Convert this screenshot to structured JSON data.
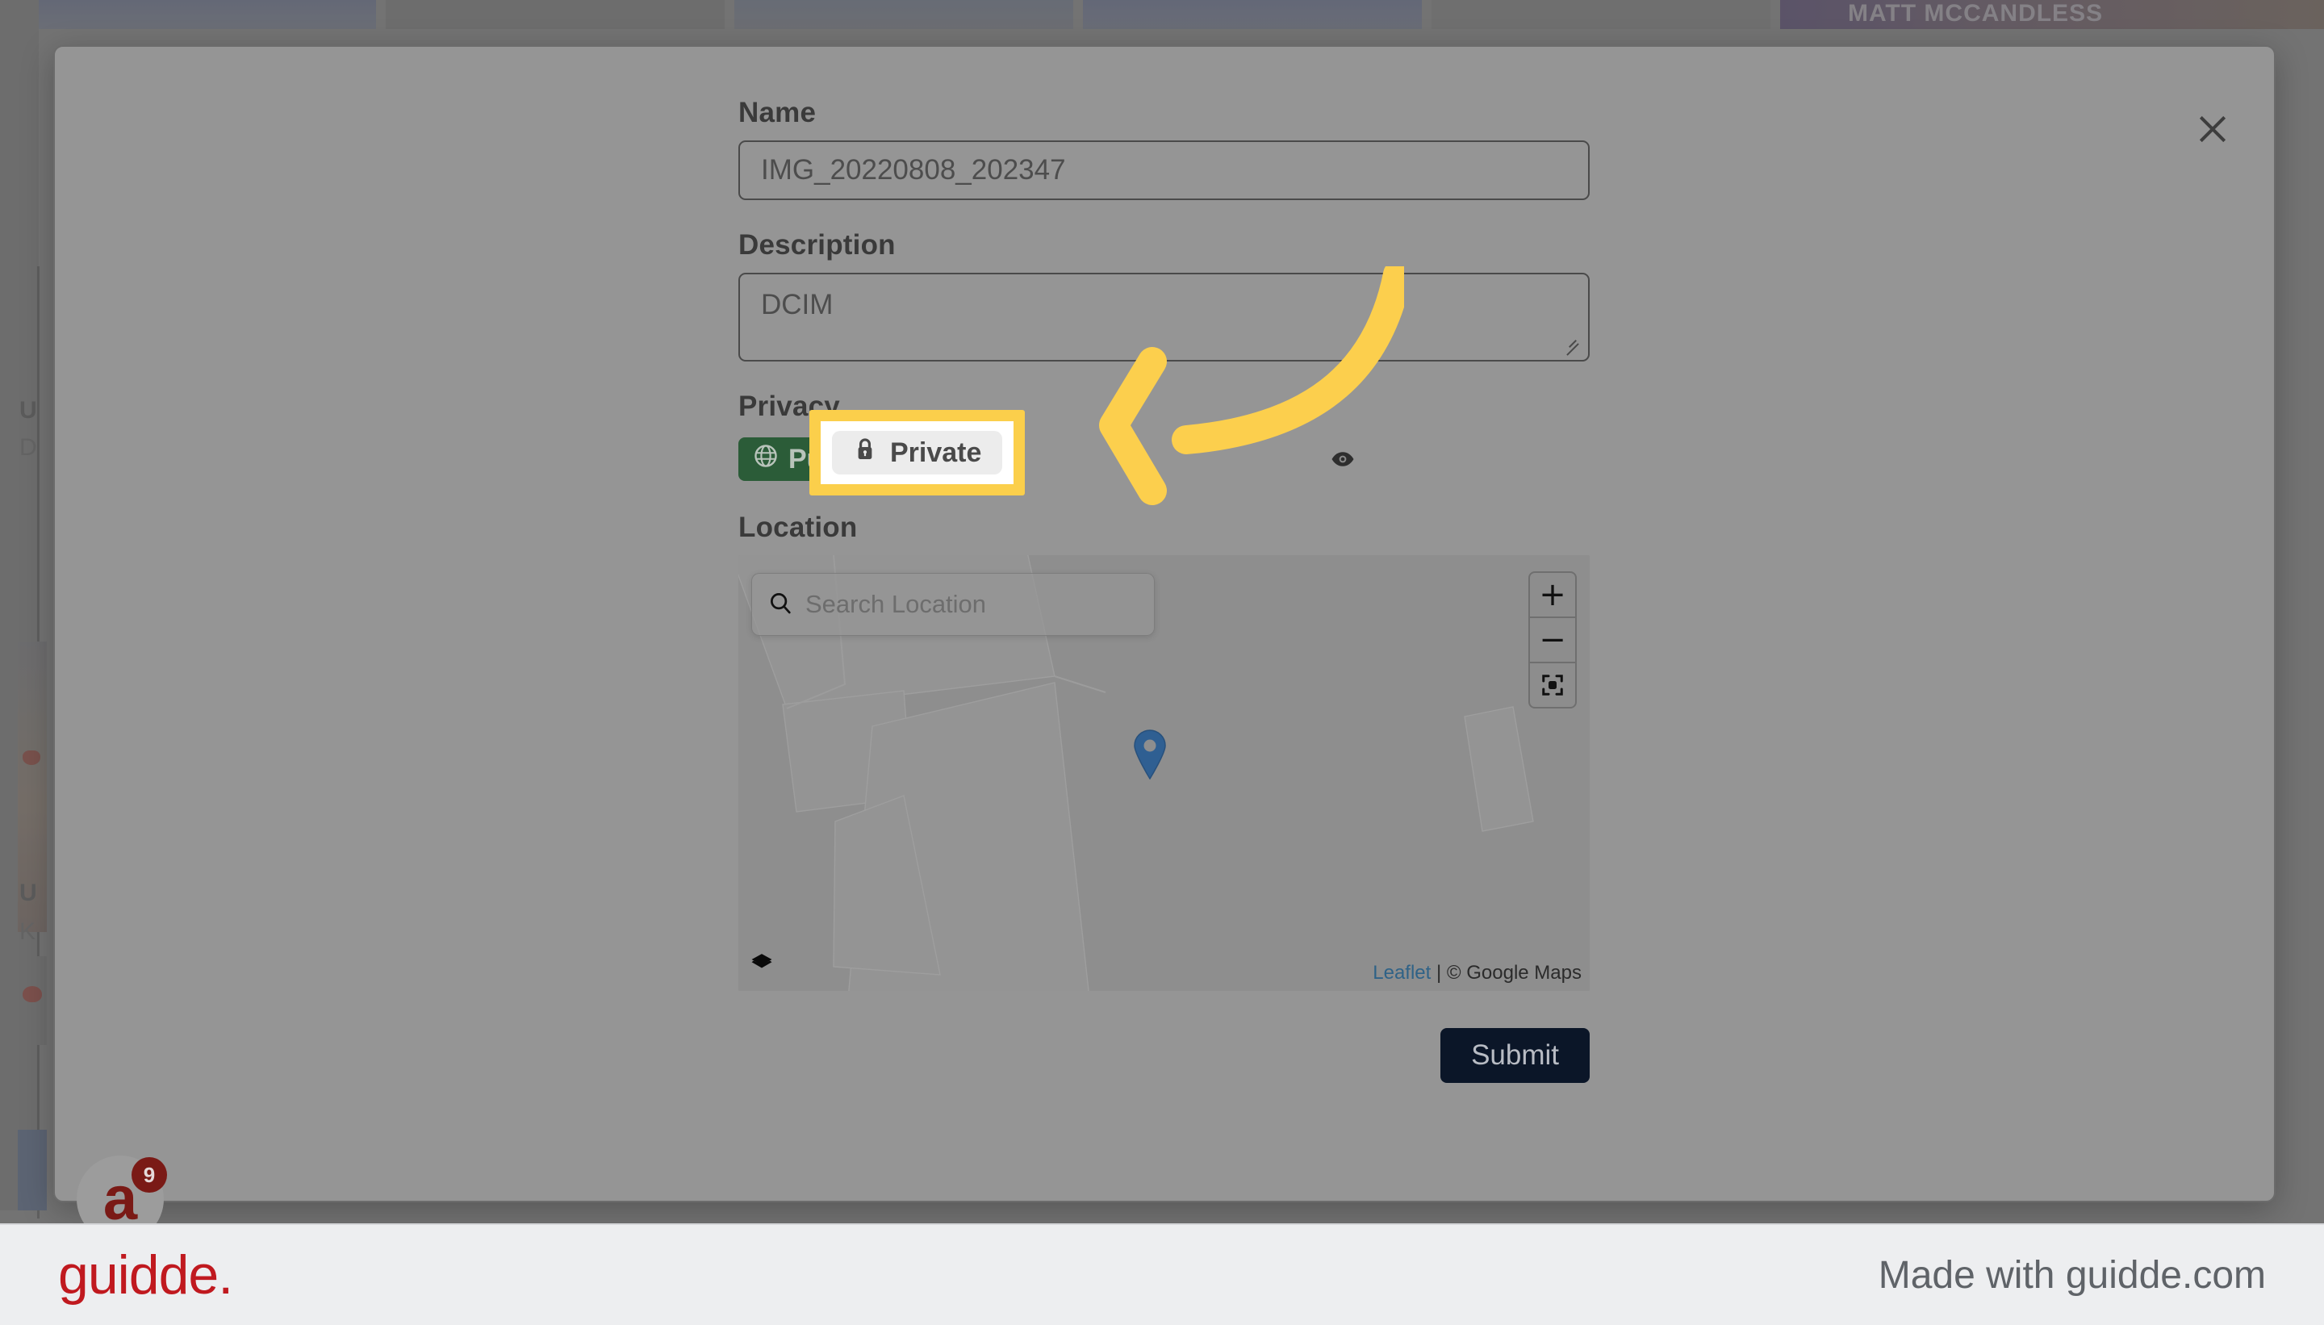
{
  "modal": {
    "close_icon": "close-icon",
    "name": {
      "label": "Name",
      "value": "IMG_20220808_202347"
    },
    "description": {
      "label": "Description",
      "value": "DCIM"
    },
    "privacy": {
      "label": "Privacy",
      "public_label": "Public",
      "public_icon": "globe-icon",
      "private_label": "Private",
      "private_icon": "lock-icon",
      "eye_icon": "eye-icon",
      "selected": "Private"
    },
    "location": {
      "label": "Location",
      "search_placeholder": "Search Location",
      "search_value": "",
      "search_icon": "search-icon",
      "zoom_in_label": "+",
      "zoom_out_label": "−",
      "locate_icon": "locate-icon",
      "layers_icon": "layers-icon",
      "marker_icon": "map-pin-icon",
      "attribution_link": "Leaflet",
      "attribution_separator": " | ",
      "attribution_text": "© Google Maps"
    },
    "submit_label": "Submit"
  },
  "background": {
    "sidebar_letters": [
      "U",
      "D",
      "U",
      "K"
    ],
    "banner_text": "MATT MCCANDLESS"
  },
  "widget": {
    "avatar_letter": "a",
    "badge_count": "9"
  },
  "footer": {
    "logo_text": "guidde.",
    "made_with": "Made with guidde.com"
  },
  "colors": {
    "highlight_yellow": "#fbcf4b",
    "arrow_yellow": "#fccf4d",
    "public_green": "#2b5c38",
    "submit_navy": "#0b1628",
    "brand_red": "#c0191f",
    "marker_blue": "#2f5f92",
    "link_blue": "#2f6287"
  }
}
